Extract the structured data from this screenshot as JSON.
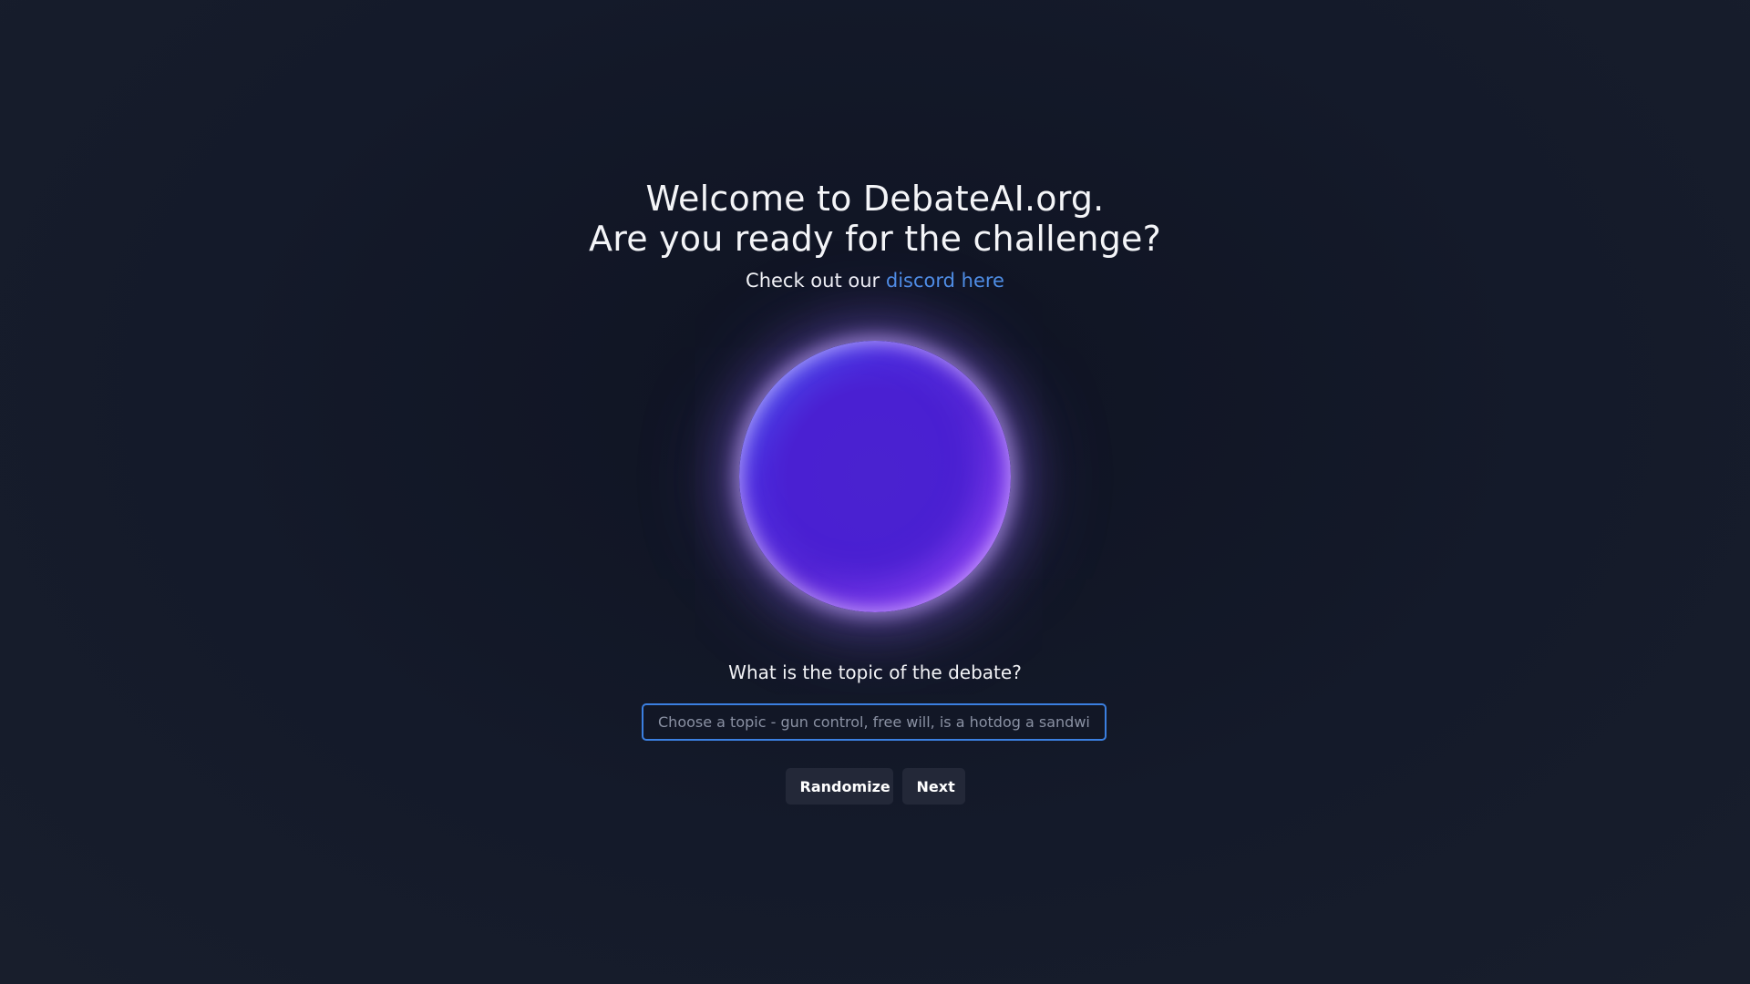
{
  "header": {
    "title_line1": "Welcome to DebateAI.org.",
    "title_line2": "Are you ready for the challenge?",
    "subtitle_prefix": "Check out our",
    "discord_link_text": "discord here"
  },
  "orb": {
    "colors": {
      "core": "#4a20d2",
      "highlight": "#4f6cf6",
      "glow": "#a35af5"
    }
  },
  "topic": {
    "question": "What is the topic of the debate?",
    "input_value": "",
    "input_placeholder": "Choose a topic - gun control, free will, is a hotdog a sandwich, etc."
  },
  "actions": {
    "randomize_label": "Randomize",
    "next_label": "Next"
  },
  "colors": {
    "background": "#141a2a",
    "link": "#4f8fe6",
    "input_border": "#3b7fe0",
    "button_bg": "#232838"
  }
}
